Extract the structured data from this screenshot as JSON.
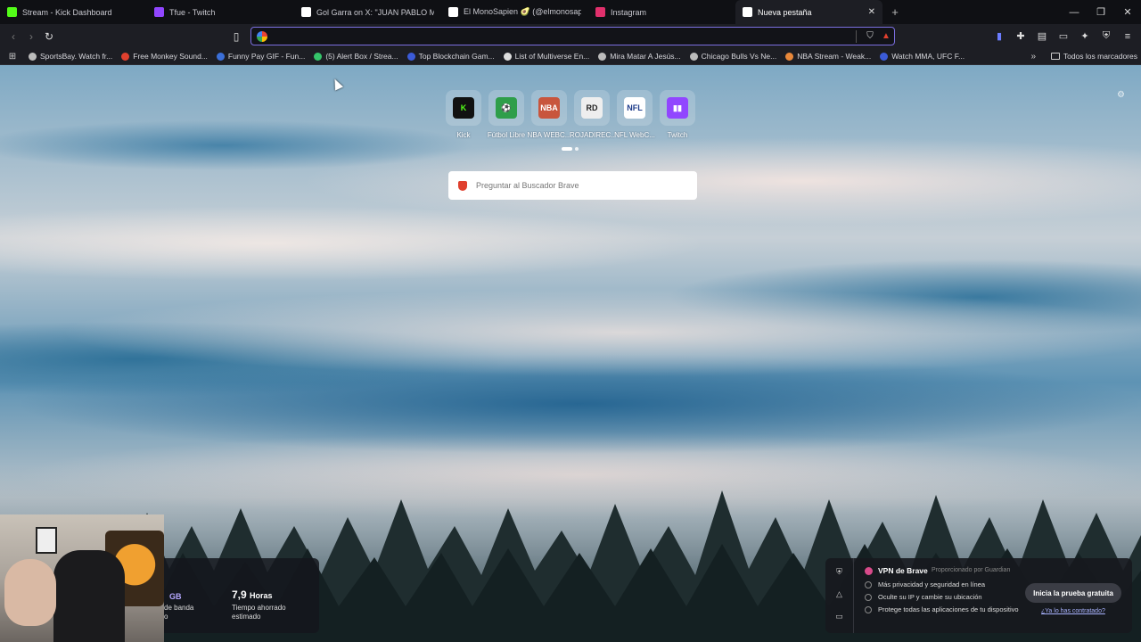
{
  "tabs": [
    {
      "label": "Stream - Kick Dashboard",
      "icon": "kick-icon",
      "color": "#53fc18",
      "active": false
    },
    {
      "label": "Tfue - Twitch",
      "icon": "twitch-icon",
      "color": "#9146ff",
      "active": false
    },
    {
      "label": "Gol Garra on X: \"JUAN PABLO MONT",
      "icon": "x-icon",
      "color": "#ffffff",
      "active": false
    },
    {
      "label": "El MonoSapien 🥑 (@elmonosapien",
      "icon": "tiktok-icon",
      "color": "#ffffff",
      "active": false
    },
    {
      "label": "Instagram",
      "icon": "instagram-icon",
      "color": "#e1306c",
      "active": false
    },
    {
      "label": "Nueva pestaña",
      "icon": "brave-tab-icon",
      "color": "#ffffff",
      "active": true
    }
  ],
  "toolbar": {
    "url_value": "",
    "url_placeholder": ""
  },
  "bookmarks": [
    {
      "label": "SportsBay. Watch fr...",
      "color": "#bbbbbb"
    },
    {
      "label": "Free Monkey Sound...",
      "color": "#e0402e"
    },
    {
      "label": "Funny Pay GIF - Fun...",
      "color": "#3b6fd8"
    },
    {
      "label": "(5) Alert Box / Strea...",
      "color": "#35c46a"
    },
    {
      "label": "Top Blockchain Gam...",
      "color": "#3b5bd8"
    },
    {
      "label": "List of Multiverse En...",
      "color": "#dddddd"
    },
    {
      "label": "Mira Matar A Jesús...",
      "color": "#bbbbbb"
    },
    {
      "label": "Chicago Bulls Vs Ne...",
      "color": "#bbbbbb"
    },
    {
      "label": "NBA Stream - Weak...",
      "color": "#e8883a"
    },
    {
      "label": "Watch MMA, UFC F...",
      "color": "#3b5bd8"
    }
  ],
  "bookmarks_all": "Todos los marcadores",
  "topsites": [
    {
      "name": "Kick",
      "logo": "K",
      "bg": "#111111",
      "fg": "#53fc18"
    },
    {
      "name": "Fútbol Libre",
      "logo": "⚽",
      "bg": "#2e9e4a",
      "fg": "#ffffff"
    },
    {
      "name": "NBA WEBC...",
      "logo": "NBA",
      "bg": "#c8553d",
      "fg": "#ffffff"
    },
    {
      "name": "ROJADIREC...",
      "logo": "RD",
      "bg": "#eeeeee",
      "fg": "#222222"
    },
    {
      "name": "NFL WebC...",
      "logo": "NFL",
      "bg": "#ffffff",
      "fg": "#1d3b8a"
    },
    {
      "name": "Twitch",
      "logo": "▮▮",
      "bg": "#9146ff",
      "fg": "#ffffff"
    }
  ],
  "search": {
    "placeholder": "Preguntar al Buscador Brave"
  },
  "stats": {
    "bandwidth_value": "GB",
    "bandwidth_label": "de banda",
    "bandwidth_label2": "o",
    "time_value": "7,9",
    "time_unit": "Horas",
    "time_label": "Tiempo ahorrado",
    "time_label2": "estimado"
  },
  "vpn": {
    "title": "VPN de Brave",
    "provider": "Proporcionado por Guardian",
    "features": [
      "Más privacidad y seguridad en línea",
      "Oculte su IP y cambie su ubicación",
      "Protege todas las aplicaciones de tu dispositivo"
    ],
    "trial_button": "Inicia la prueba gratuita",
    "already_link": "¿Ya lo has contratado?"
  },
  "colors": {
    "accent": "#7b6fe0",
    "brave_red": "#e0402e"
  }
}
